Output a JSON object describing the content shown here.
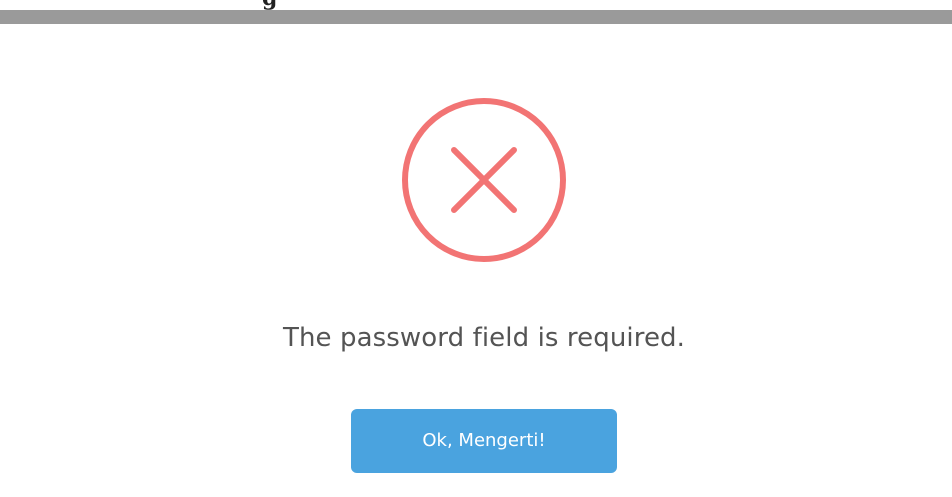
{
  "backdrop": {
    "partial_heading": "g"
  },
  "dialog": {
    "icon": "error-x-icon",
    "icon_color": "#f27474",
    "message": "The password field is required.",
    "confirm_label": "Ok, Mengerti!",
    "confirm_color": "#4aa3df"
  }
}
